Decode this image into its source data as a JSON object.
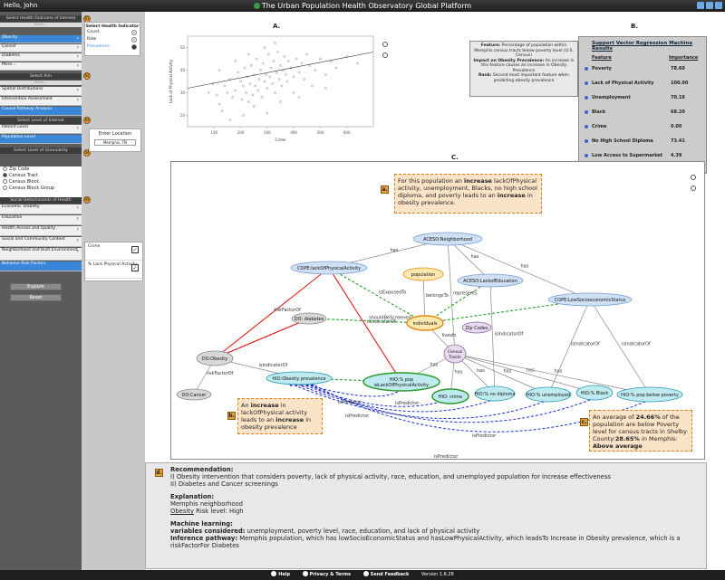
{
  "topbar": {
    "greeting": "Hello, John",
    "title": "The Urban Population Health Observatory Global Platform"
  },
  "sidebar": {
    "sections": [
      {
        "num": "01",
        "label": "Select Health Outcome of Interest"
      },
      {
        "num": "02",
        "label": "Select Aim"
      },
      {
        "num": "03",
        "label": "Select Level of Interest"
      },
      {
        "num": "04",
        "label": "Select Level of Granularity"
      },
      {
        "num": "05",
        "label": "Social Determinants of Health"
      }
    ],
    "select_placeholder": "Select...",
    "outcomes": [
      "Obesity",
      "Cancer",
      "Diabetes",
      "More..."
    ],
    "aims": [
      "Spatial Distributions",
      "Intervention Assessment",
      "Causal Pathway Analysis"
    ],
    "levels": [
      "Patient Level",
      "Population Level"
    ],
    "granularity": [
      "Zip Code",
      "Census Tract",
      "Census Block",
      "Census Block Group"
    ],
    "sdoh": [
      "Economic Stability",
      "Education",
      "Health Access and Quality",
      "Social and Community Context",
      "Neighborhood and Built Environment",
      "Behavior Risk Factors"
    ],
    "buttons": {
      "explore": "Explore",
      "reset": "Reset"
    }
  },
  "indicator": {
    "title": "Select Health Indicator",
    "options": [
      "Count",
      "Rate",
      "Prevalence"
    ]
  },
  "location": {
    "title": "Enter Location",
    "value": "Memphis, TN"
  },
  "risk_factors": [
    "Crime",
    "% Lack Physical Activity"
  ],
  "labels": {
    "a": "A.",
    "b": "B.",
    "c": "C."
  },
  "chart_data": {
    "type": "scatter",
    "xlabel": "Crime",
    "ylabel": "Lack of Physical Activity",
    "xlim": [
      0,
      700
    ],
    "ylim": [
      15,
      55
    ],
    "xticks": [
      100,
      200,
      300,
      400,
      500,
      600
    ],
    "yticks": [
      20,
      30,
      40,
      50
    ],
    "trend": [
      [
        0,
        32
      ],
      [
        700,
        48
      ]
    ],
    "points": [
      [
        80,
        30
      ],
      [
        95,
        34
      ],
      [
        110,
        29
      ],
      [
        120,
        25
      ],
      [
        130,
        22
      ],
      [
        140,
        33
      ],
      [
        150,
        30
      ],
      [
        160,
        36
      ],
      [
        170,
        28
      ],
      [
        180,
        31
      ],
      [
        190,
        39
      ],
      [
        200,
        35
      ],
      [
        205,
        27
      ],
      [
        210,
        33
      ],
      [
        215,
        41
      ],
      [
        220,
        30
      ],
      [
        225,
        37
      ],
      [
        230,
        26
      ],
      [
        235,
        34
      ],
      [
        240,
        42
      ],
      [
        245,
        29
      ],
      [
        250,
        38
      ],
      [
        255,
        33
      ],
      [
        260,
        45
      ],
      [
        265,
        31
      ],
      [
        270,
        36
      ],
      [
        275,
        40
      ],
      [
        280,
        28
      ],
      [
        285,
        43
      ],
      [
        290,
        35
      ],
      [
        295,
        38
      ],
      [
        300,
        32
      ],
      [
        305,
        47
      ],
      [
        310,
        37
      ],
      [
        315,
        41
      ],
      [
        320,
        34
      ],
      [
        325,
        44
      ],
      [
        330,
        30
      ],
      [
        335,
        39
      ],
      [
        340,
        48
      ],
      [
        345,
        36
      ],
      [
        350,
        42
      ],
      [
        355,
        33
      ],
      [
        360,
        40
      ],
      [
        365,
        46
      ],
      [
        370,
        38
      ],
      [
        375,
        35
      ],
      [
        380,
        44
      ],
      [
        390,
        41
      ],
      [
        400,
        37
      ],
      [
        410,
        45
      ],
      [
        420,
        39
      ],
      [
        430,
        43
      ],
      [
        440,
        36
      ],
      [
        450,
        47
      ],
      [
        460,
        42
      ],
      [
        480,
        40
      ],
      [
        500,
        45
      ],
      [
        520,
        38
      ],
      [
        540,
        44
      ],
      [
        560,
        41
      ],
      [
        600,
        46
      ],
      [
        640,
        43
      ],
      [
        120,
        40
      ],
      [
        180,
        44
      ],
      [
        230,
        47
      ],
      [
        290,
        50
      ],
      [
        330,
        52
      ],
      [
        250,
        24
      ],
      [
        300,
        21
      ],
      [
        350,
        26
      ],
      [
        400,
        30
      ],
      [
        160,
        18
      ],
      [
        210,
        20
      ],
      [
        420,
        28
      ],
      [
        470,
        33
      ],
      [
        520,
        32
      ]
    ]
  },
  "feature_box": {
    "feature_label": "Feature:",
    "feature_text": "Percentage of population within Memphis census tracts below poverty level (U.S. Census)",
    "impact_label": "Impact on Obesity Prevalence:",
    "impact_text": "An increase in this feature causes an increase in Obesity Prevalence",
    "rank_label": "Rank:",
    "rank_text": "Second most important feature when predicting obesity prevalence"
  },
  "svr": {
    "title": "Support Vector Regression Machine Results",
    "feature_header": "Feature",
    "importance_header": "Importance",
    "rows": [
      {
        "feature": "Poverty",
        "importance": "78.60"
      },
      {
        "feature": "Lack of Physical Activity",
        "importance": "100.00"
      },
      {
        "feature": "Unemployment",
        "importance": "70.16"
      },
      {
        "feature": "Black",
        "importance": "68.20"
      },
      {
        "feature": "Crime",
        "importance": "0.00"
      },
      {
        "feature": "No High School Diploma",
        "importance": "73.41"
      },
      {
        "feature": "Low Access to Supermarket",
        "importance": "4.39"
      }
    ]
  },
  "graph": {
    "nodes": {
      "neighborhood": "ACESO:Neighborhood",
      "lack_activity": "COPE:lackOfPhysicalActivity",
      "population": "population",
      "lack_education": "ACESO:LackofEducation",
      "low_ses": "COPE:LowSocioeconomicStatus",
      "diabetes": "DO: diabetes",
      "individuals": "individuals",
      "zip": "Zip Codes",
      "census": "Census Tracts",
      "obesity": "DO:Obesity",
      "cancer": "DO:Cancer",
      "obesity_prev": "HIO:Obesity prevalence",
      "pop_lack": "HIO:% pop wLackOfPhysicalActivity",
      "crime": "HIO: crime",
      "no_diploma": "HIO:% no diploma",
      "unemployed": "HIO:% unemployed",
      "black": "HIO:% Black",
      "poverty": "HIO:% pop below poverty"
    },
    "edges": {
      "has": "has",
      "is_exposed_to": "isExposedTo",
      "belongs_to": "belongsTo",
      "represents": "represents",
      "should_be_screened": "shouldBeScreened",
      "risk_factor_of": "riskFactorOf",
      "is_indicator_of": "isIndicatorOf",
      "lives_in": "livesIn",
      "is_predictor": "isPredictor"
    },
    "callouts": {
      "a_pre": "For this population an ",
      "a_b1": "increase",
      "a_mid": " lackOfPhysical activity, unemployment, Blacks, no high school diploma, and poverty leads to an ",
      "a_b2": "increase",
      "a_post": " in obesity prevalence.",
      "b_pre": "An ",
      "b_b1": "increase",
      "b_mid": " in lackOfPhysical activity leads to an ",
      "b_b2": "increase",
      "b_post": " in obesity prevalence",
      "c_pre": "An average of ",
      "c_b1": "24.66%",
      "c_mid": " of the population are below Poverty level for census tracts in Shelby County:",
      "c_b2": "28.65%",
      "c_mid2": " in Memphis: ",
      "c_b3": "Above average"
    },
    "badges": {
      "a": "a.",
      "b": "b.",
      "c": "c.",
      "d": "d."
    }
  },
  "recommendation": {
    "heading": "Recommendation:",
    "line1": "I) Obesity intervention that considers poverty, lack of physical activity, race, education, and unemployed population for increase effectiveness",
    "line2": "II) Diabetes and Cancer screenings",
    "explanation_heading": "Explanation:",
    "explanation_line": "Memphis neighborhood",
    "risk_label": "Obesity",
    "risk_suffix": " Risk level",
    "risk_value": ": High",
    "ml_heading": "Machine learning:",
    "vars_label": "variables considered:",
    "vars_text": " unemployment, poverty level, race, education, and lack of physical activity",
    "path_label": "Inference pathway:",
    "path_text": " Memphis population, which has lowSocioEconomicStatus and hasLowPhysicalActivity, which leadsTo Increase in Obesity prevalence, which is a riskFactorFor Diabetes"
  },
  "footer": {
    "help": "Help",
    "privacy": "Privacy & Terms",
    "feedback": "Send Feedback",
    "version": "Version 1.6.28"
  },
  "colors": {
    "accent": "#3a86d8",
    "callout": "#fbe3c7",
    "badge": "#e0a040",
    "red_edge": "#e02020",
    "green_edge": "#2a9a2a",
    "blue_edge": "#2030c8"
  }
}
